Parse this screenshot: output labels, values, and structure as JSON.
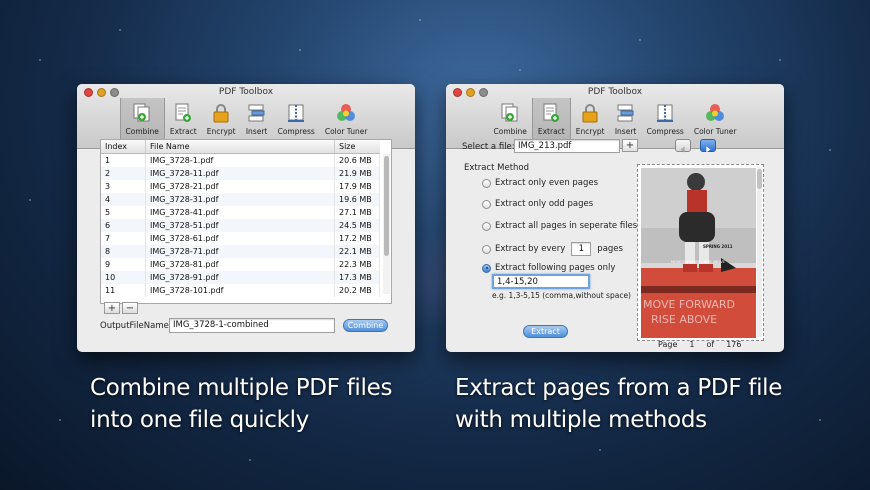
{
  "left_window": {
    "title": "PDF Toolbox",
    "toolbar": [
      {
        "label": "Combine",
        "icon": "combine-icon",
        "active": true
      },
      {
        "label": "Extract",
        "icon": "extract-icon",
        "active": false
      },
      {
        "label": "Encrypt",
        "icon": "encrypt-icon",
        "active": false
      },
      {
        "label": "Insert",
        "icon": "insert-icon",
        "active": false
      },
      {
        "label": "Compress",
        "icon": "compress-icon",
        "active": false
      },
      {
        "label": "Color Tuner",
        "icon": "color-tuner-icon",
        "active": false
      }
    ],
    "table": {
      "headers": [
        "Index",
        "File Name",
        "Size"
      ],
      "rows": [
        [
          "1",
          "IMG_3728-1.pdf",
          "20.6 MB"
        ],
        [
          "2",
          "IMG_3728-11.pdf",
          "21.9 MB"
        ],
        [
          "3",
          "IMG_3728-21.pdf",
          "17.9 MB"
        ],
        [
          "4",
          "IMG_3728-31.pdf",
          "19.6 MB"
        ],
        [
          "5",
          "IMG_3728-41.pdf",
          "27.1 MB"
        ],
        [
          "6",
          "IMG_3728-51.pdf",
          "24.5 MB"
        ],
        [
          "7",
          "IMG_3728-61.pdf",
          "17.2 MB"
        ],
        [
          "8",
          "IMG_3728-71.pdf",
          "22.1 MB"
        ],
        [
          "9",
          "IMG_3728-81.pdf",
          "22.3 MB"
        ],
        [
          "10",
          "IMG_3728-91.pdf",
          "17.3 MB"
        ],
        [
          "11",
          "IMG_3728-101.pdf",
          "20.2 MB"
        ]
      ]
    },
    "add_label": "+",
    "remove_label": "−",
    "output_label": "OutputFileName:",
    "output_value": "IMG_3728-1-combined",
    "combine_button": "Combine"
  },
  "right_window": {
    "title": "PDF Toolbox",
    "toolbar": [
      {
        "label": "Combine",
        "icon": "combine-icon",
        "active": false
      },
      {
        "label": "Extract",
        "icon": "extract-icon",
        "active": true
      },
      {
        "label": "Encrypt",
        "icon": "encrypt-icon",
        "active": false
      },
      {
        "label": "Insert",
        "icon": "insert-icon",
        "active": false
      },
      {
        "label": "Compress",
        "icon": "compress-icon",
        "active": false
      },
      {
        "label": "Color Tuner",
        "icon": "color-tuner-icon",
        "active": false
      }
    ],
    "select_label": "Select a file:",
    "file_value": "IMG_213.pdf",
    "add_label": "+",
    "method_title": "Extract Method",
    "options": {
      "even": "Extract only even pages",
      "odd": "Extract only odd pages",
      "all": "Extract all pages in seperate files",
      "every": "Extract by every",
      "every_value": "1",
      "every_unit": "pages",
      "following": "Extract following pages only",
      "following_value": "1,4-15,20",
      "hint": "e.g. 1,3-5,15 (comma,without space)"
    },
    "selected_option": "following",
    "extract_button": "Extract",
    "preview": {
      "page_label": "Page",
      "page_current": "1",
      "of_label": "of",
      "page_total": "176",
      "image_text_1": "SPRING 2011",
      "image_text_2": "MOVE FORWARD | RISE ABOVE",
      "image_text_3": "MOVE FORWARD",
      "image_text_4": "RISE ABOVE"
    }
  },
  "captions": {
    "left_line1": "Combine multiple PDF files",
    "left_line2": "into one file quickly",
    "right_line1": "Extract pages from a PDF file",
    "right_line2": "with multiple methods"
  },
  "colors": {
    "accent": "#4c8fda",
    "background": "#142a48",
    "preview_red": "#c0392b"
  }
}
